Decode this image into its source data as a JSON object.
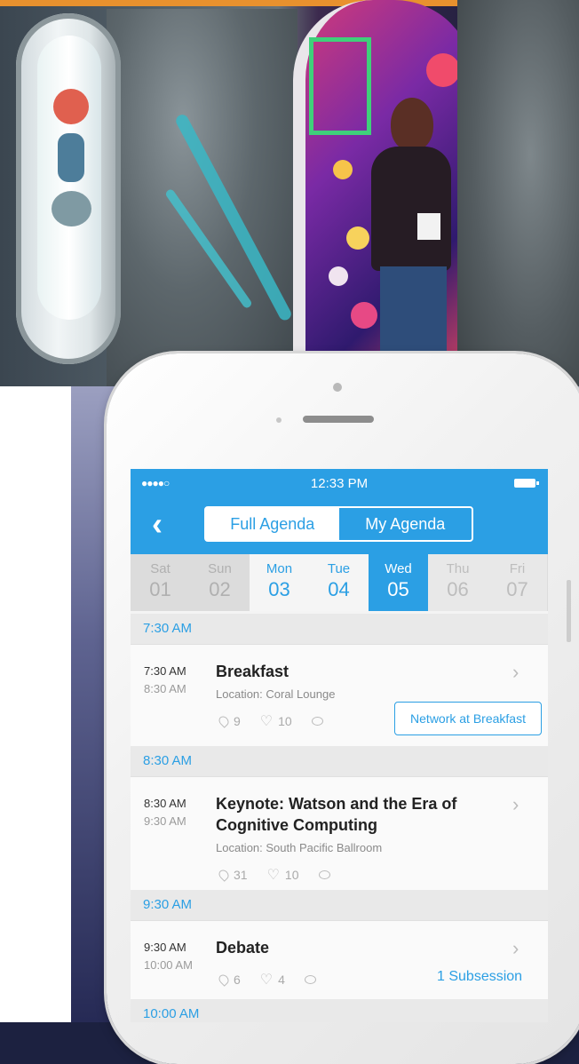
{
  "status_bar": {
    "signal": "●●●●○",
    "time": "12:33 PM"
  },
  "nav": {
    "back_icon": "chevron-left-icon",
    "tabs": [
      "Full Agenda",
      "My Agenda"
    ],
    "active_tab": "Full Agenda"
  },
  "days": [
    {
      "name": "Sat",
      "num": "01"
    },
    {
      "name": "Sun",
      "num": "02"
    },
    {
      "name": "Mon",
      "num": "03"
    },
    {
      "name": "Tue",
      "num": "04"
    },
    {
      "name": "Wed",
      "num": "05"
    },
    {
      "name": "Thu",
      "num": "06"
    },
    {
      "name": "Fri",
      "num": "07"
    }
  ],
  "sections": [
    "7:30 AM",
    "8:30 AM",
    "9:30 AM",
    "10:00 AM"
  ],
  "sessions": [
    {
      "start": "7:30 AM",
      "end": "8:30 AM",
      "title": "Breakfast",
      "location": "Location: Coral Lounge",
      "pins": "9",
      "likes": "10",
      "action": "Network at Breakfast"
    },
    {
      "start": "8:30 AM",
      "end": "9:30 AM",
      "title": "Keynote: Watson and the Era of Cognitive Computing",
      "location": "Location: South Pacific Ballroom",
      "pins": "31",
      "likes": "10"
    },
    {
      "start": "9:30 AM",
      "end": "10:00 AM",
      "title": "Debate",
      "pins": "6",
      "likes": "4",
      "subsession": "1 Subsession"
    }
  ],
  "colors": {
    "accent": "#2b9fe4",
    "photo_bar": "#e8912e"
  }
}
